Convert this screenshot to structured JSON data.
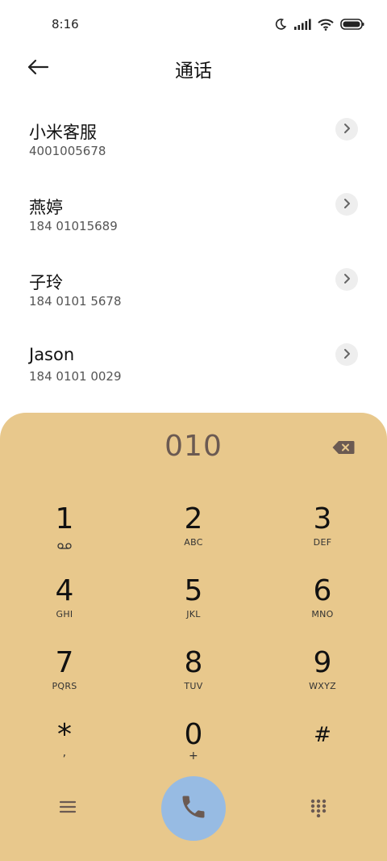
{
  "status": {
    "time": "8:16"
  },
  "header": {
    "title": "通话"
  },
  "contacts": [
    {
      "name": "小米客服",
      "phone": "4001005678"
    },
    {
      "name": "燕婷",
      "phone": "184 01015689"
    },
    {
      "name": "子玲",
      "phone": "184 0101 5678"
    },
    {
      "name": "Jason",
      "phone": "184 0101 0029"
    }
  ],
  "dialpad": {
    "input": "010",
    "keys": [
      {
        "digit": "1",
        "letters": ""
      },
      {
        "digit": "2",
        "letters": "ABC"
      },
      {
        "digit": "3",
        "letters": "DEF"
      },
      {
        "digit": "4",
        "letters": "GHI"
      },
      {
        "digit": "5",
        "letters": "JKL"
      },
      {
        "digit": "6",
        "letters": "MNO"
      },
      {
        "digit": "7",
        "letters": "PQRS"
      },
      {
        "digit": "8",
        "letters": "TUV"
      },
      {
        "digit": "9",
        "letters": "WXYZ"
      },
      {
        "digit": "*",
        "letters": ","
      },
      {
        "digit": "0",
        "letters": "+"
      },
      {
        "digit": "#",
        "letters": ""
      }
    ],
    "colors": {
      "panel": "#e8c88c",
      "call": "#97bbe3",
      "input_text": "#6b5a52"
    }
  },
  "icons": [
    "moon-icon",
    "signal-icon",
    "wifi-icon",
    "battery-icon",
    "back-arrow-icon",
    "chevron-right-icon",
    "backspace-icon",
    "voicemail-icon",
    "menu-icon",
    "phone-icon",
    "keypad-icon"
  ]
}
